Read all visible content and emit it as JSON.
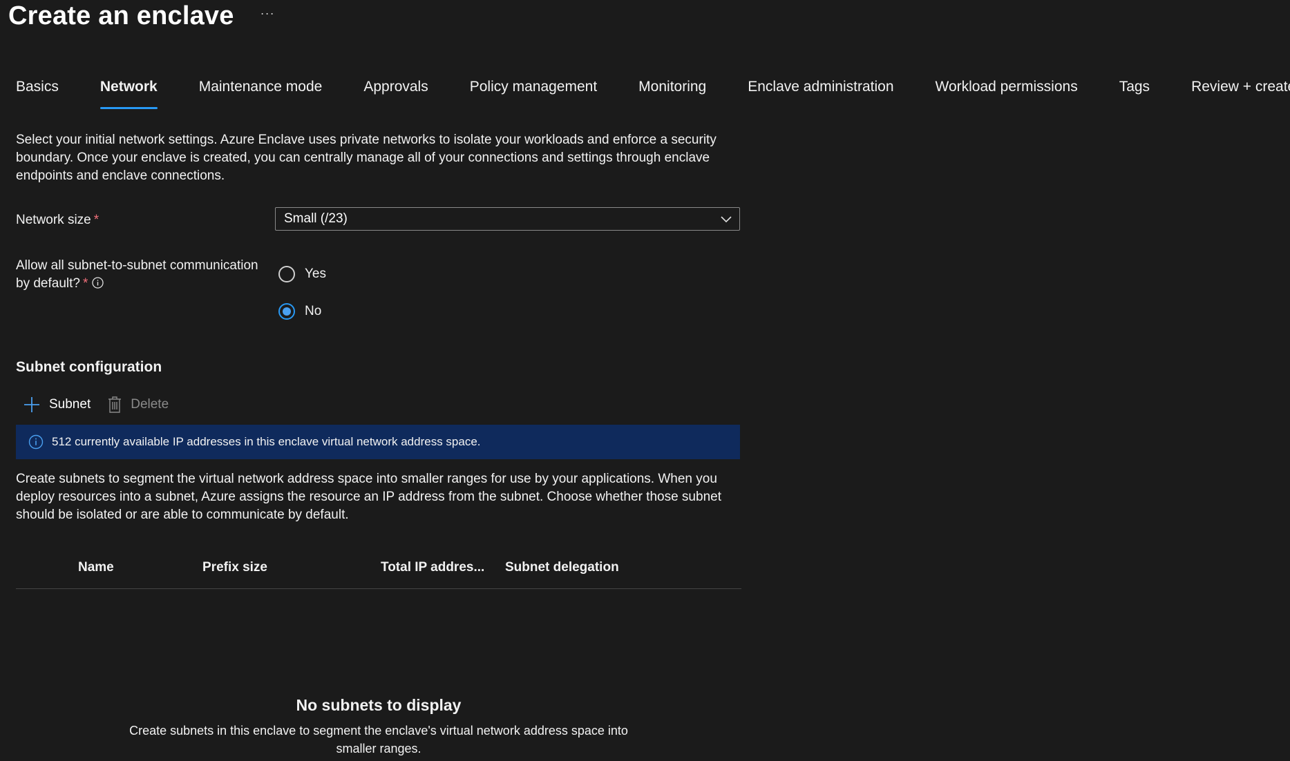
{
  "header": {
    "title": "Create an enclave",
    "more_label": "···"
  },
  "tabs": [
    {
      "label": "Basics",
      "active": false
    },
    {
      "label": "Network",
      "active": true
    },
    {
      "label": "Maintenance mode",
      "active": false
    },
    {
      "label": "Approvals",
      "active": false
    },
    {
      "label": "Policy management",
      "active": false
    },
    {
      "label": "Monitoring",
      "active": false
    },
    {
      "label": "Enclave administration",
      "active": false
    },
    {
      "label": "Workload permissions",
      "active": false
    },
    {
      "label": "Tags",
      "active": false
    },
    {
      "label": "Review + create",
      "active": false
    }
  ],
  "intro": "Select your initial network settings. Azure Enclave uses private networks to isolate your workloads and enforce a security boundary. Once your enclave is created, you can centrally manage all of your connections and settings through enclave endpoints and enclave connections.",
  "network_size": {
    "label": "Network size",
    "required_mark": "*",
    "value": "Small (/23)"
  },
  "subnet_comm": {
    "label_line1": "Allow all subnet-to-subnet communication",
    "label_line2": "by default?",
    "required_mark": "*",
    "options": [
      {
        "label": "Yes",
        "checked": false
      },
      {
        "label": "No",
        "checked": true
      }
    ]
  },
  "subnet_config": {
    "title": "Subnet configuration",
    "add_label": "Subnet",
    "delete_label": "Delete",
    "banner": "512 currently available IP addresses in this enclave virtual network address space.",
    "description": "Create subnets to segment the virtual network address space into smaller ranges for use by your applications. When you deploy resources into a subnet, Azure assigns the resource an IP address from the subnet. Choose whether those subnet should be isolated or are able to communicate by default.",
    "columns": [
      "Name",
      "Prefix size",
      "Total IP addres...",
      "Subnet delegation"
    ],
    "empty_title": "No subnets to display",
    "empty_desc": "Create subnets in this enclave to segment the enclave's virtual network address space into smaller ranges."
  },
  "colors": {
    "background": "#1b1b1b",
    "accent": "#2899f5",
    "banner": "#0f2a5c",
    "required": "#f1707b"
  }
}
